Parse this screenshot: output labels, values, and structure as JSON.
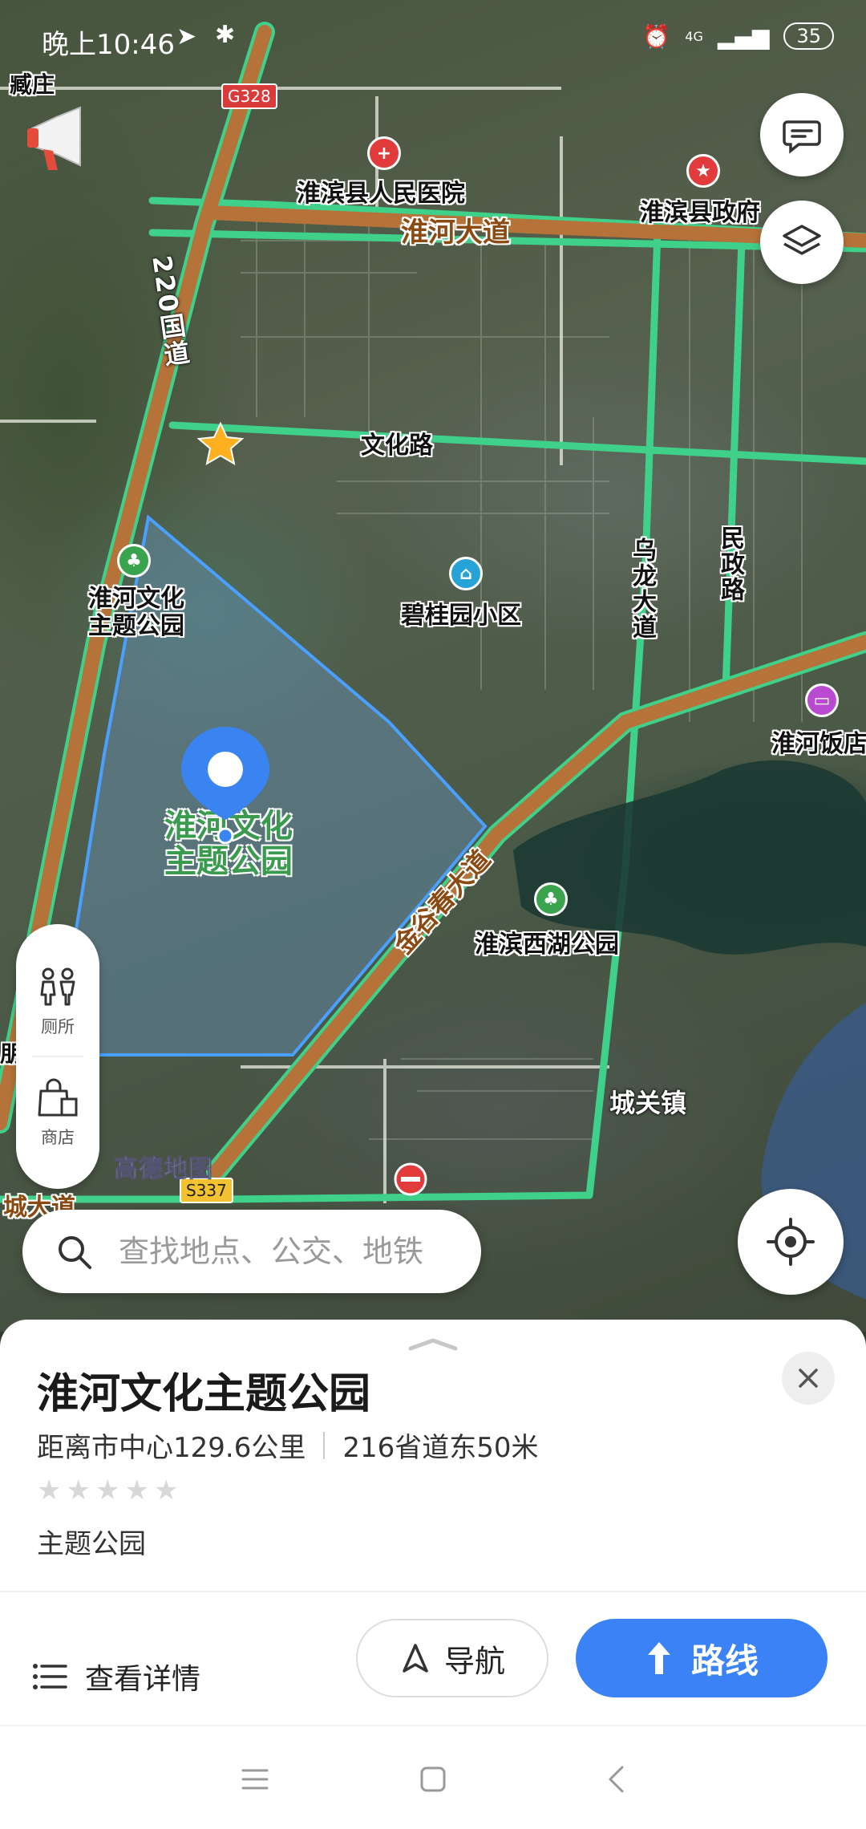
{
  "status_bar": {
    "time": "晚上10:46",
    "battery": "35",
    "network": "4G"
  },
  "map": {
    "roads": {
      "g328": "G328",
      "s337": "S337",
      "guodao": "220国道",
      "huaihe_dadao": "淮河大道",
      "wenhua_lu": "文化路",
      "wulong_dadao": "乌龙大道",
      "minzheng_lu": "民政路",
      "jingu": "金谷春大道",
      "chengda": "城大道"
    },
    "places": {
      "cangzhuang": "臧庄",
      "hospital": "淮滨县人民医院",
      "government": "淮滨县政府",
      "biguiyuan": "碧桂园小区",
      "park_small": "淮河文化主题公园",
      "park_big_line1": "淮河文化",
      "park_big_line2": "主题公园",
      "xihu": "淮滨西湖公园",
      "hotel": "淮河饭店",
      "chengguan": "城关镇",
      "edge_left": "朋"
    },
    "watermark": "高德地图"
  },
  "side_panel": {
    "toilet": "厕所",
    "shop": "商店"
  },
  "search": {
    "placeholder": "查找地点、公交、地铁"
  },
  "sheet": {
    "title": "淮河文化主题公园",
    "distance": "距离市中心129.6公里",
    "road_info": "216省道东50米",
    "rating": 0,
    "rating_max": 5,
    "category": "主题公园",
    "details_label": "查看详情",
    "nav_label": "导航",
    "route_label": "路线"
  },
  "colors": {
    "accent": "#3b82f6",
    "road_green": "#3fd08a",
    "road_orange": "#b5733a",
    "area_fill": "#6ea0d8"
  }
}
